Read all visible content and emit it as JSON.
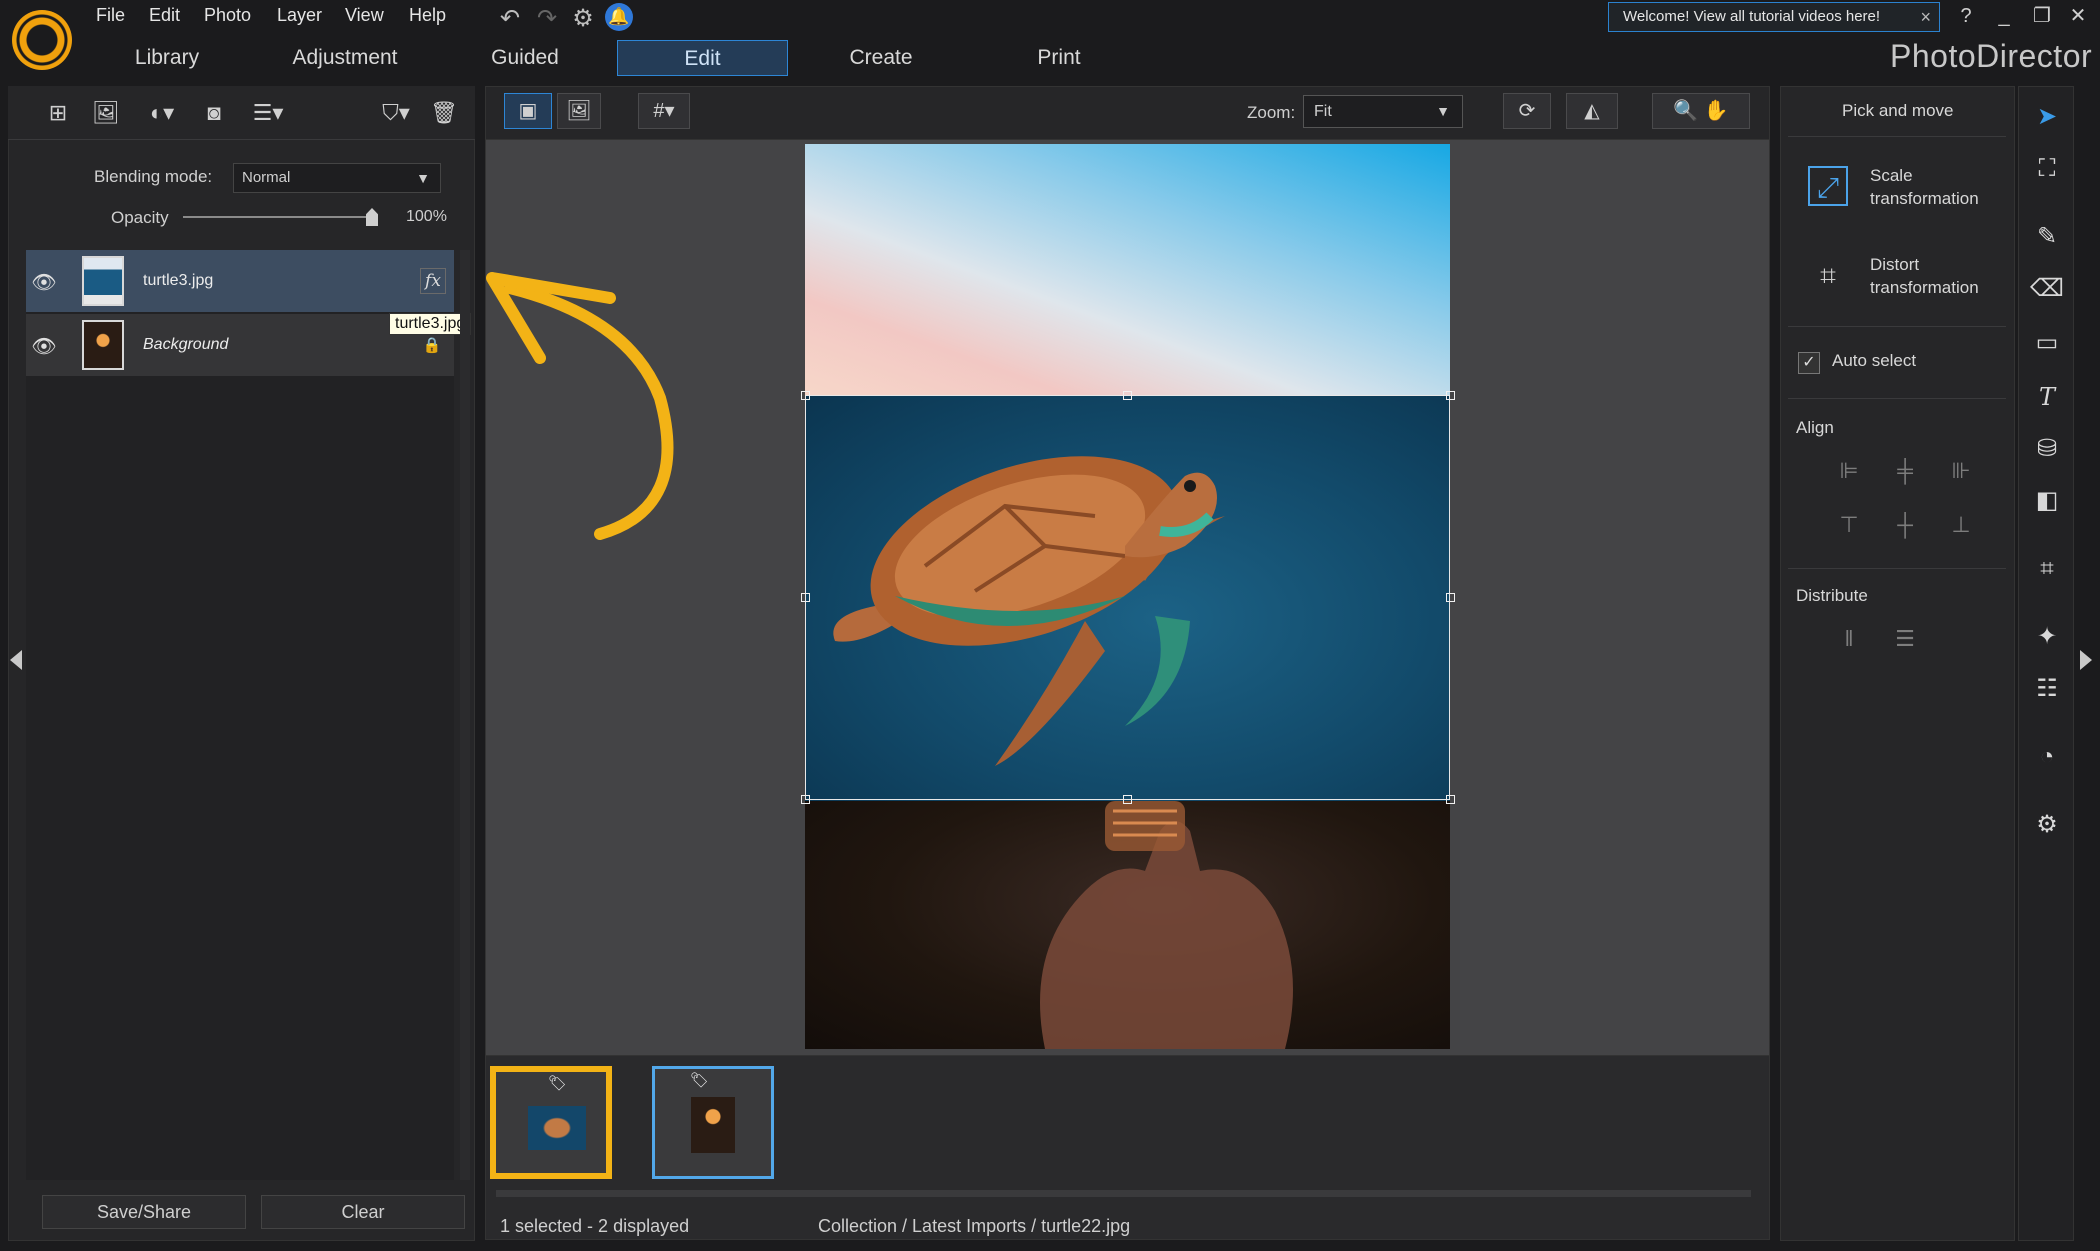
{
  "app": {
    "brand": "PhotoDirector",
    "menu": [
      "File",
      "Edit",
      "Photo",
      "Layer",
      "View",
      "Help"
    ],
    "welcome_text": "Welcome! View all tutorial videos here!",
    "welcome_close": "×",
    "help": "?",
    "minimize": "_",
    "restore": "❐",
    "close": "✕"
  },
  "modules": [
    {
      "label": "Library"
    },
    {
      "label": "Adjustment"
    },
    {
      "label": "Guided"
    },
    {
      "label": "Edit",
      "active": true
    },
    {
      "label": "Create"
    },
    {
      "label": "Print"
    }
  ],
  "layers_panel": {
    "blending_label": "Blending mode:",
    "blending_value": "Normal",
    "opacity_label": "Opacity",
    "opacity_value": "100%",
    "opacity": 1.0,
    "layers": [
      {
        "name": "turtle3.jpg",
        "fx": "fx",
        "selected": true
      },
      {
        "name": "Background",
        "locked": true
      }
    ],
    "tooltip": "turtle3.jpg",
    "save_share": "Save/Share",
    "clear": "Clear"
  },
  "canvas_toolbar": {
    "zoom_label": "Zoom:",
    "zoom_value": "Fit"
  },
  "status": {
    "selection": "1 selected - 2 displayed",
    "path": "Collection / Latest Imports / turtle22.jpg"
  },
  "right_panel": {
    "title": "Pick and move",
    "scale": [
      "Scale",
      "transformation"
    ],
    "distort": [
      "Distort",
      "transformation"
    ],
    "auto_select": "Auto select",
    "auto_select_checked": true,
    "align_label": "Align",
    "distribute_label": "Distribute"
  },
  "colors": {
    "accent": "#2d86d6",
    "highlight": "#f3b316",
    "panel": "#262628"
  }
}
